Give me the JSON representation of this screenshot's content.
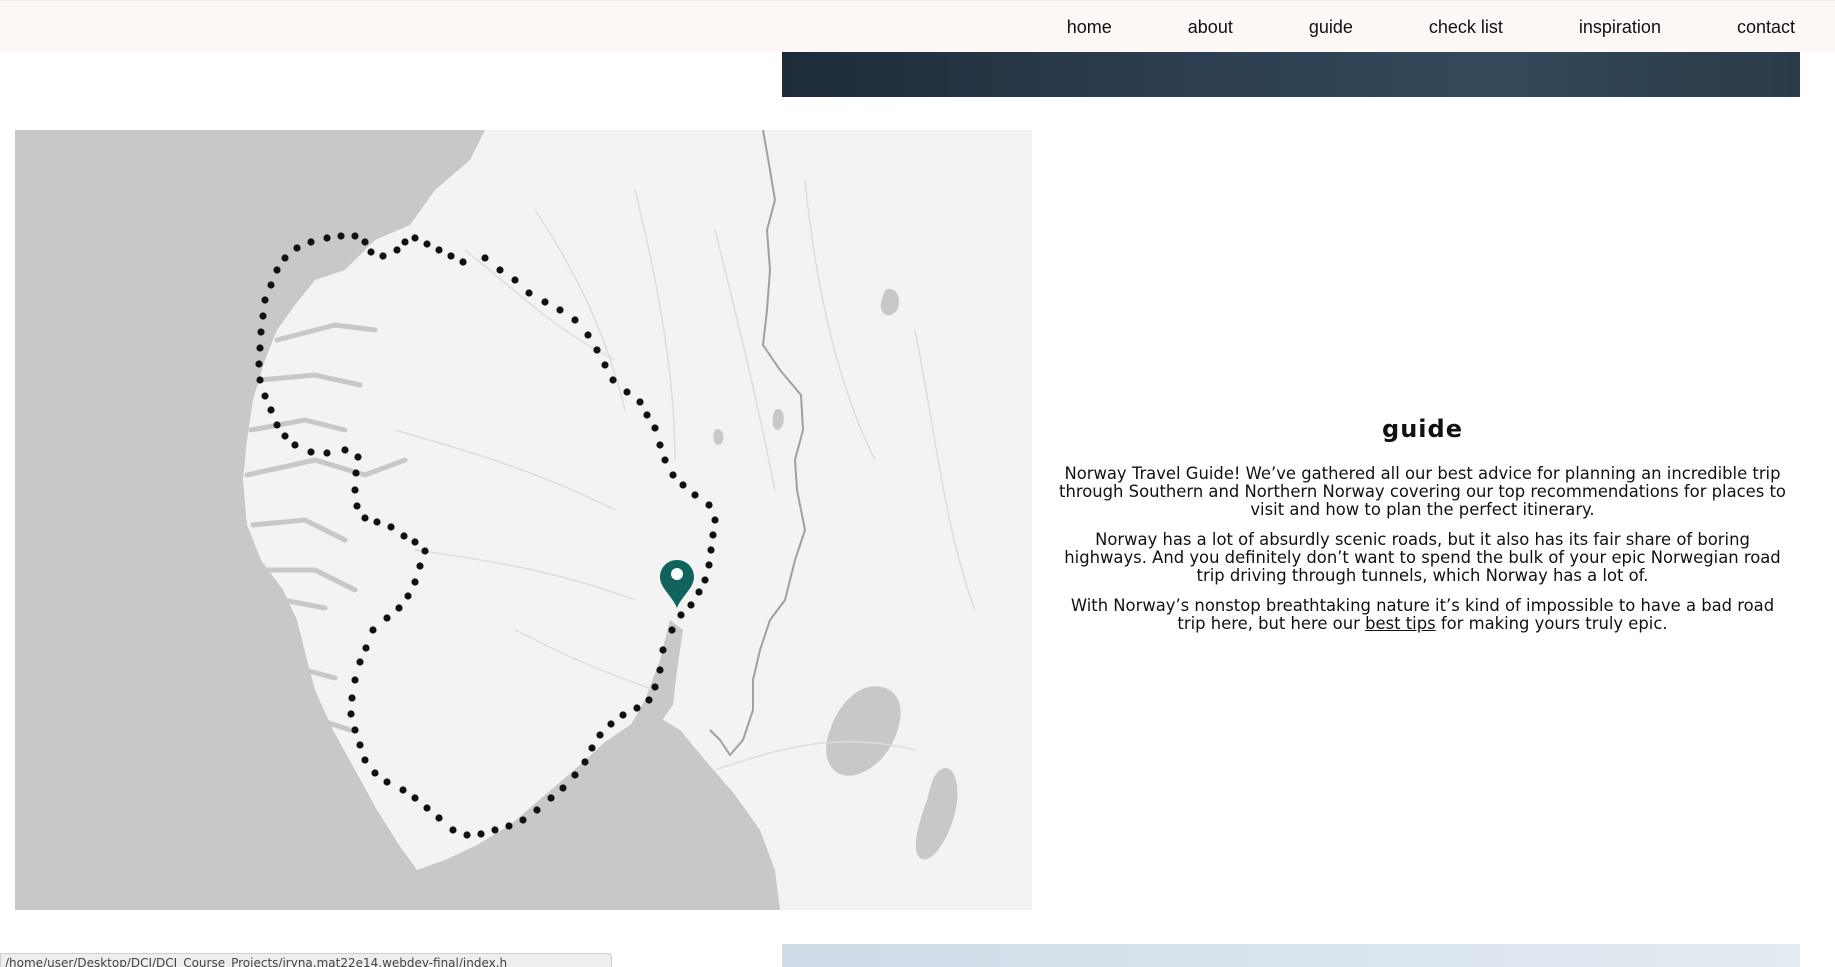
{
  "nav": {
    "items": [
      {
        "label": "home"
      },
      {
        "label": "about"
      },
      {
        "label": "guide"
      },
      {
        "label": "check list"
      },
      {
        "label": "inspiration"
      },
      {
        "label": "contact"
      }
    ]
  },
  "map": {
    "marker_color": "#10635c",
    "route_color": "#111111",
    "water_color": "#c8c8c8",
    "land_color": "#f3f3f3"
  },
  "guide": {
    "title": "guide",
    "paragraph_1": "Norway Travel Guide! We’ve gathered all our best advice for planning an incredible trip through Southern and Northern Norway covering our top recommendations for places to visit and how to plan the perfect itinerary.",
    "paragraph_2": "Norway has a lot of absurdly scenic roads, but it also has its fair share of boring highways. And you definitely don’t want to spend the bulk of your epic Norwegian road trip driving through tunnels, which Norway has a lot of.",
    "paragraph_3_before": "With Norway’s nonstop breathtaking nature it’s kind of impossible to have a bad road trip here, but here our ",
    "paragraph_3_link": "best tips",
    "paragraph_3_after": " for making yours truly epic."
  },
  "status_bar": {
    "url": "/home/user/Desktop/DCI/DCI_Course_Projects/iryna.mat22e14.webdev-final/index.h"
  }
}
